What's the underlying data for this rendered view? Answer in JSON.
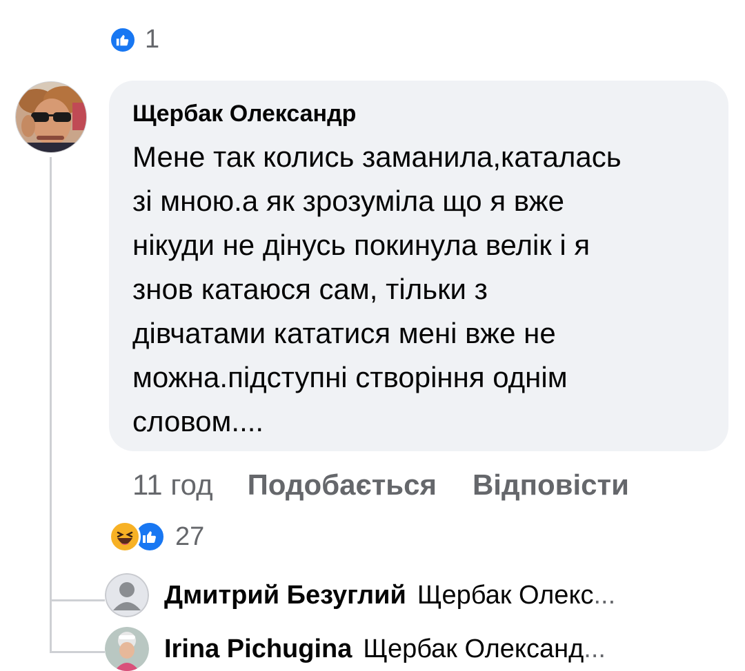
{
  "top_reaction": {
    "count": "1",
    "icon": "like-icon"
  },
  "comment": {
    "author": "Щербак Олександр",
    "text_lines": [
      "Мене так колись заманила,каталась",
      "зі мною.а як зрозуміла що я вже",
      "нікуди не дінусь покинула велік і я",
      "знов катаюся сам, тільки з",
      "дівчатами кататися мені вже не",
      "можна.підступні створіння однім",
      "словом...."
    ],
    "time": "11 год",
    "like_label": "Подобається",
    "reply_label": "Відповісти",
    "reaction_count": "27"
  },
  "replies": [
    {
      "name": "Дмитрий Безуглий",
      "text": "Щербак Олекс",
      "ellipsis": "..."
    },
    {
      "name": "Irina  Pichugina",
      "text": "Щербак Олександ",
      "ellipsis": "..."
    }
  ],
  "colors": {
    "accent": "#1877f2",
    "bubble": "#f0f2f5",
    "muted": "#65676b",
    "haha": "#f7b125"
  }
}
